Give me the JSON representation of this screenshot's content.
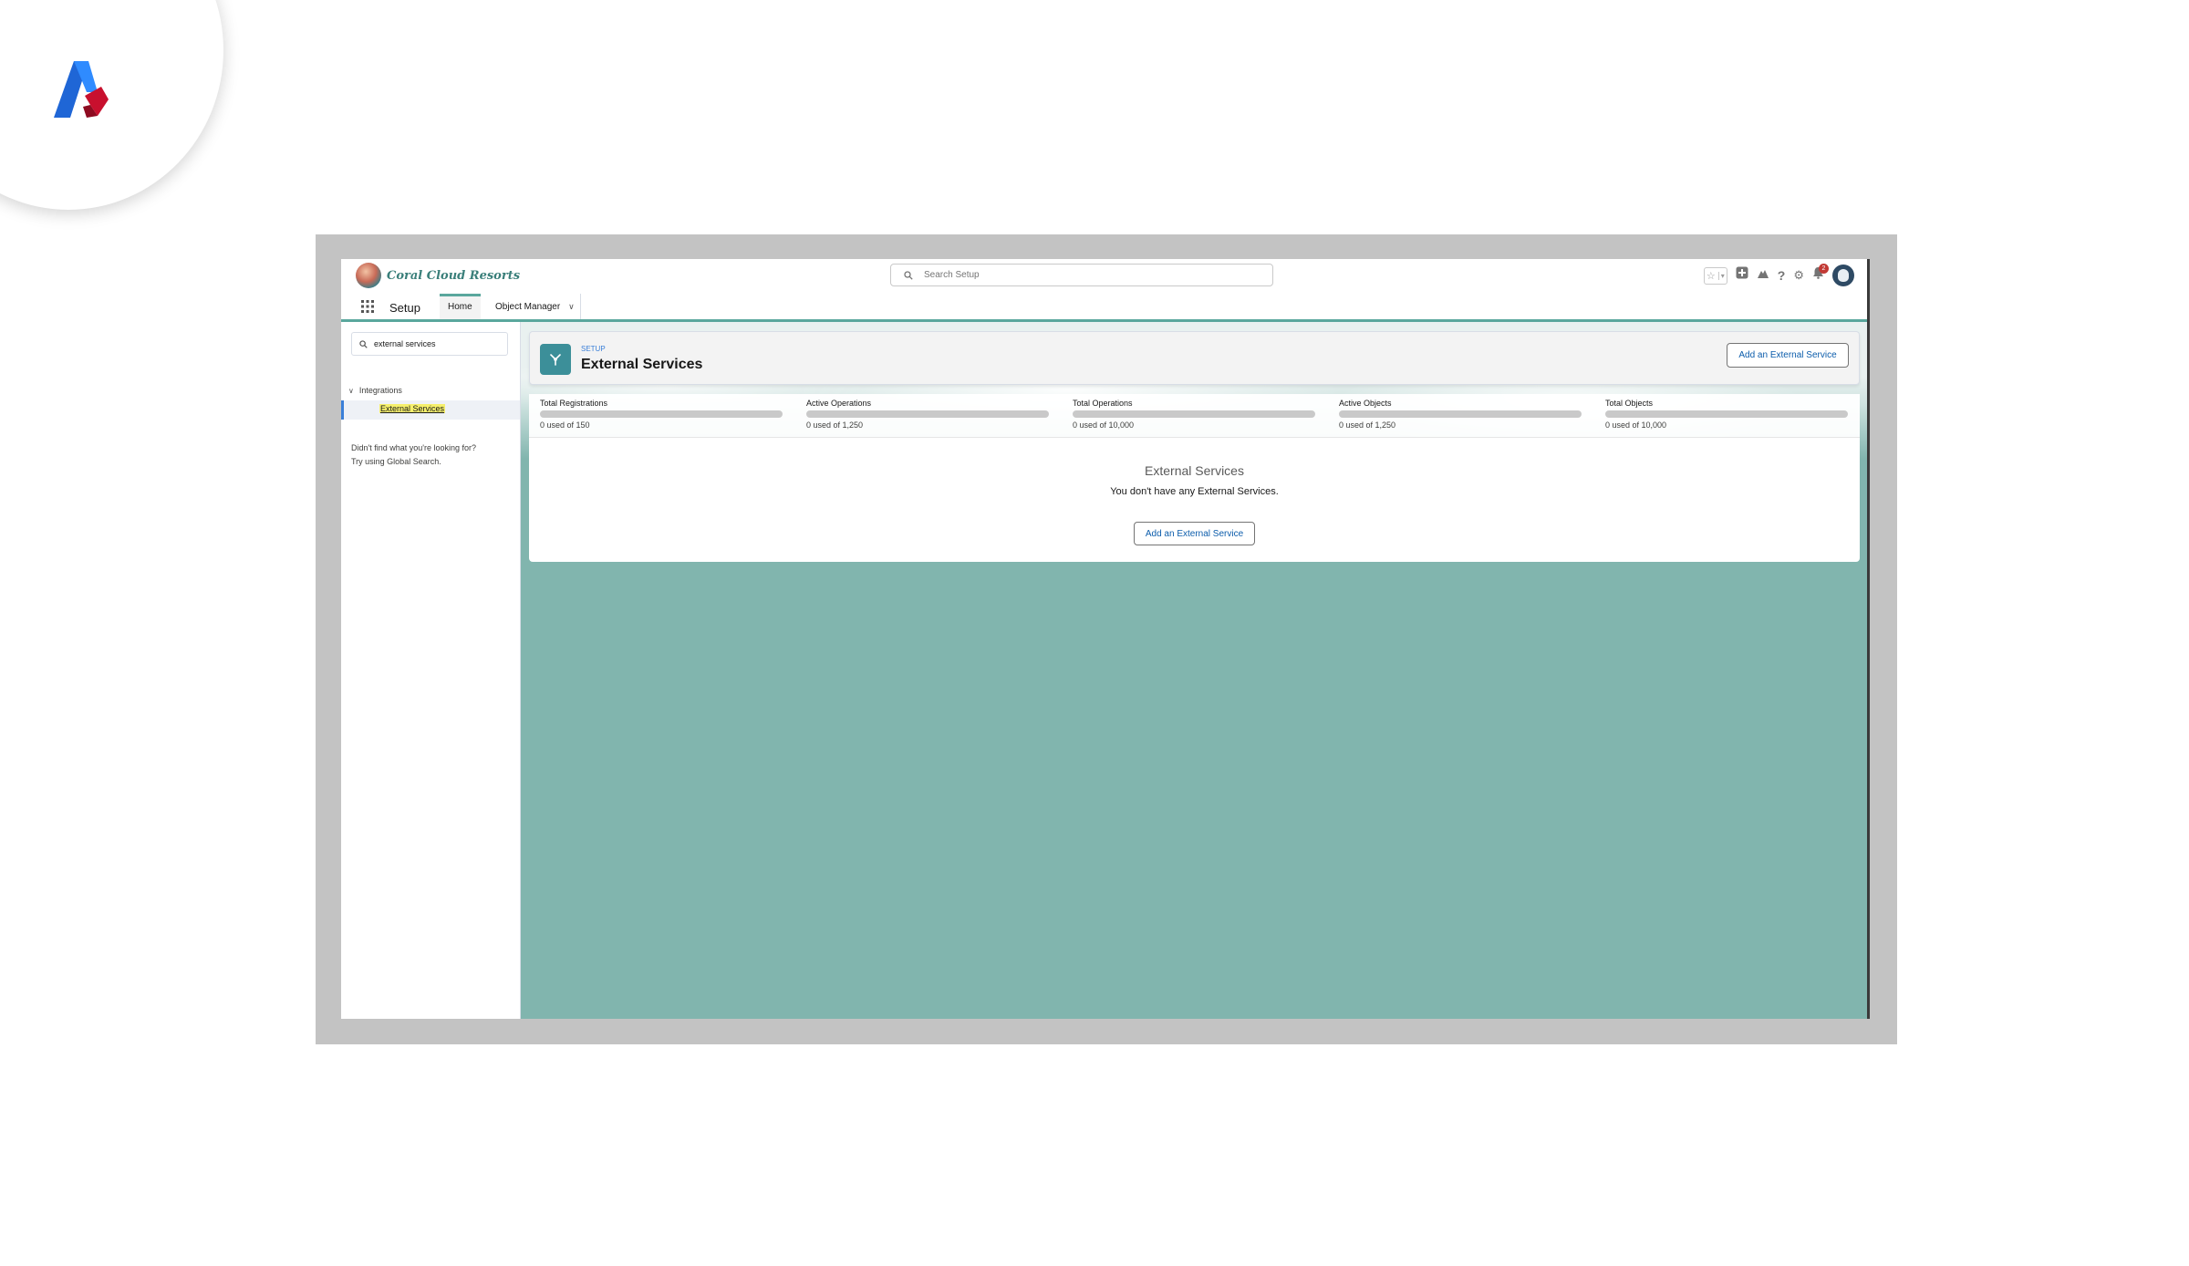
{
  "brand": {
    "org_name": "Coral Cloud Resorts"
  },
  "global_search": {
    "placeholder": "Search Setup"
  },
  "header_icons": {
    "notification_count": "2",
    "icons": [
      "favorites-star-icon",
      "add-icon",
      "trailhead-icon",
      "help-icon",
      "gear-icon",
      "bell-icon",
      "avatar"
    ]
  },
  "nav": {
    "app_name": "Setup",
    "tabs": [
      {
        "label": "Home",
        "active": true
      },
      {
        "label": "Object Manager",
        "active": false
      }
    ]
  },
  "sidebar": {
    "quick_find_value": "external services",
    "group_label": "Integrations",
    "selected_item": "External Services",
    "help_line1": "Didn't find what you're looking for?",
    "help_line2": "Try using Global Search."
  },
  "page_header": {
    "eyebrow": "SETUP",
    "title": "External Services",
    "action_button": "Add an External Service"
  },
  "stats": [
    {
      "label": "Total Registrations",
      "usage": "0 used of 150",
      "fill_fraction": 0
    },
    {
      "label": "Active Operations",
      "usage": "0 used of 1,250",
      "fill_fraction": 0
    },
    {
      "label": "Total Operations",
      "usage": "0 used of 10,000",
      "fill_fraction": 0
    },
    {
      "label": "Active Objects",
      "usage": "0 used of 1,250",
      "fill_fraction": 0
    },
    {
      "label": "Total Objects",
      "usage": "0 used of 10,000",
      "fill_fraction": 0
    }
  ],
  "empty_state": {
    "title": "External Services",
    "message": "You don't have any External Services.",
    "button": "Add an External Service"
  },
  "colors": {
    "accent": "#5aa79d",
    "background_teal": "#81b5ae",
    "link_blue": "#0b5cab",
    "notification_red": "#c23934"
  }
}
